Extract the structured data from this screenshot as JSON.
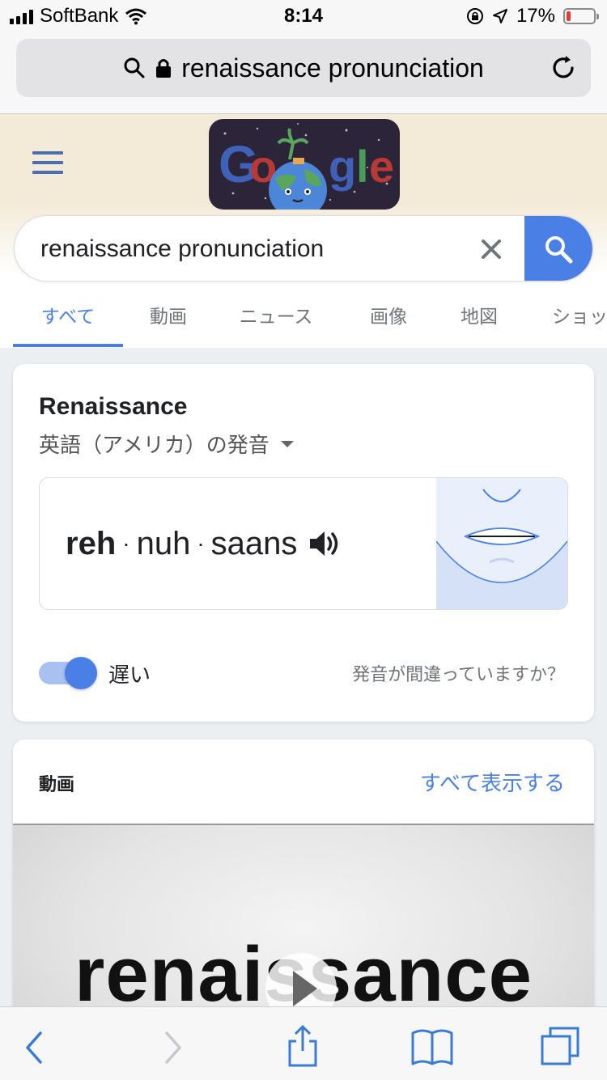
{
  "status_bar": {
    "carrier": "SoftBank",
    "time": "8:14",
    "battery_percent": "17%",
    "battery_level": 0.17,
    "battery_color": "#e53935"
  },
  "browser": {
    "url_text": "renaissance pronunciation",
    "icons": [
      "search-icon",
      "lock-icon",
      "reload-icon"
    ]
  },
  "google": {
    "doodle_letters": "Go gle",
    "search_query": "renaissance pronunciation",
    "accent_color": "#4a7fe6",
    "tabs": [
      {
        "label": "すべて",
        "active": true
      },
      {
        "label": "動画",
        "active": false
      },
      {
        "label": "ニュース",
        "active": false
      },
      {
        "label": "画像",
        "active": false
      },
      {
        "label": "地図",
        "active": false
      },
      {
        "label": "ショッ",
        "active": false
      }
    ]
  },
  "pronunciation": {
    "word": "Renaissance",
    "dialect": "英語（アメリカ）の発音",
    "syllable_stressed": "reh",
    "syllable_2": "nuh",
    "syllable_3": "saans",
    "separator": "·",
    "slow_label": "遅い",
    "slow_enabled": true,
    "feedback_link": "発音が間違っていますか？"
  },
  "videos": {
    "heading": "動画",
    "show_all": "すべて表示する",
    "thumbnail_text": "renaissance"
  },
  "toolbar": {
    "icons": [
      "back-icon",
      "forward-icon",
      "share-icon",
      "bookmarks-icon",
      "tabs-icon"
    ]
  }
}
